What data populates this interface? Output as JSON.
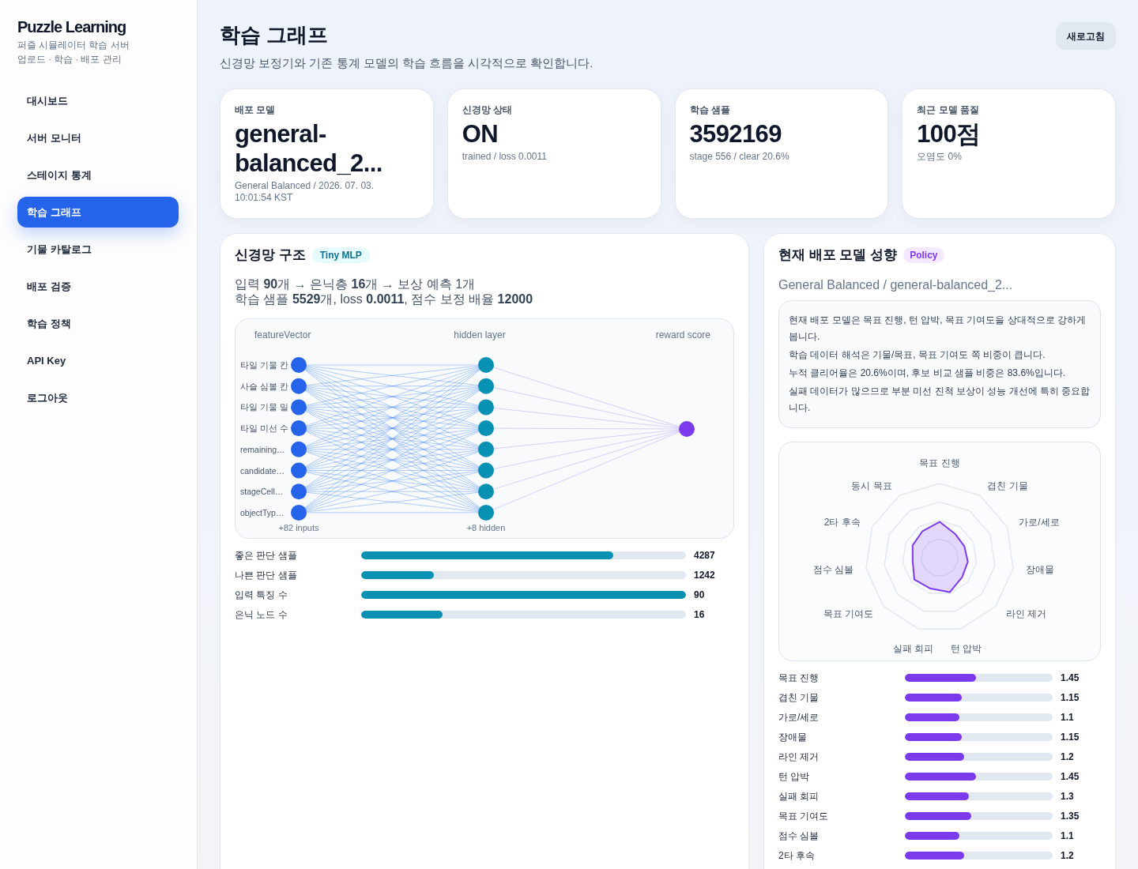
{
  "sidebar": {
    "brand": "Puzzle Learning",
    "tagline": [
      "퍼즐 시뮬레이터 학습 서버",
      "업로드 · 학습 · 배포 관리"
    ],
    "items": [
      {
        "label": "대시보드",
        "selected": false
      },
      {
        "label": "서버 모니터",
        "selected": false
      },
      {
        "label": "스테이지 통계",
        "selected": false
      },
      {
        "label": "학습 그래프",
        "selected": true
      },
      {
        "label": "기물 카탈로그",
        "selected": false
      },
      {
        "label": "배포 검증",
        "selected": false
      },
      {
        "label": "학습 정책",
        "selected": false
      },
      {
        "label": "API Key",
        "selected": false
      },
      {
        "label": "로그아웃",
        "selected": false
      }
    ]
  },
  "header": {
    "title": "학습 그래프",
    "subtitle": "신경망 보정기와 기존 통계 모델의 학습 흐름을 시각적으로 확인합니다.",
    "refresh_button": "새로고침"
  },
  "stat_cards": [
    {
      "label": "배포 모델",
      "value": "general-balanced_2...",
      "caption": "General Balanced / 2026. 07. 03. 10:01:54 KST"
    },
    {
      "label": "신경망 상태",
      "value": "ON",
      "caption": "trained / loss 0.0011"
    },
    {
      "label": "학습 샘플",
      "value": "3592169",
      "caption": "stage 556 / clear 20.6%"
    },
    {
      "label": "최근 모델 품질",
      "value": "100점",
      "caption": "오염도 0%"
    }
  ],
  "network_panel": {
    "title": "신경망 구조",
    "badge": "Tiny MLP",
    "summary": [
      "입력 **90**개 → 은닉층 **16**개 → 보상 예측 1개",
      "학습 샘플 **5529**개, loss **0.0011**, 점수 보정 배율 **12000**"
    ],
    "diagram": {
      "layers": [
        "featureVector",
        "hidden layer",
        "reward score"
      ],
      "input_features": [
        "타일 기물 칸",
        "사슬 심볼 칸",
        "타일 기물 밀",
        "타일 미선 수",
        "remaining…",
        "candidate…",
        "stageCell…",
        "objectTyp…"
      ],
      "more_inputs": "+82 inputs",
      "more_hidden": "+8 hidden"
    },
    "bars": [
      {
        "label": "좋은 판단 샘플",
        "level": 0.775,
        "value": "4287"
      },
      {
        "label": "나쁜 판단 샘플",
        "level": 0.225,
        "value": "1242"
      },
      {
        "label": "입력 특징 수",
        "level": 1,
        "value": "90"
      },
      {
        "label": "은닉 노드 수",
        "level": 0.25,
        "value": "16"
      }
    ]
  },
  "policy_panel": {
    "title": "현재 배포 모델 성향",
    "badge": "Policy",
    "model": "General Balanced / general-balanced_2...",
    "notes": [
      "현재 배포 모델은 목표 진행, 턴 압박, 목표 기여도을 상대적으로 강하게 봅니다.",
      "학습 데이터 해석은 기물/목표, 목표 기여도 쪽 비중이 큽니다.",
      "누적 클리어율은 20.6%이며, 후보 비교 샘플 비중은 83.6%입니다.",
      "실패 데이터가 많으므로 부분 미선 진척 보상이 성능 개선에 특히 중요합니다."
    ],
    "radar_axes": [
      "목표 진행",
      "동시 목표",
      "겹친 기물",
      "2타 후속",
      "가로/세로",
      "점수 심볼",
      "장애물",
      "목표 기여도",
      "라인 제거",
      "실패 회피",
      "턴 압박"
    ],
    "weights": [
      {
        "label": "목표 진행",
        "level": 0.483,
        "value": "1.45"
      },
      {
        "label": "겹친 기물",
        "level": 0.383,
        "value": "1.15"
      },
      {
        "label": "가로/세로",
        "level": 0.367,
        "value": "1.1"
      },
      {
        "label": "장애물",
        "level": 0.383,
        "value": "1.15"
      },
      {
        "label": "라인 제거",
        "level": 0.4,
        "value": "1.2"
      },
      {
        "label": "턴 압박",
        "level": 0.483,
        "value": "1.45"
      },
      {
        "label": "실패 회피",
        "level": 0.433,
        "value": "1.3"
      },
      {
        "label": "목표 기여도",
        "level": 0.45,
        "value": "1.35"
      },
      {
        "label": "점수 심볼",
        "level": 0.367,
        "value": "1.1"
      },
      {
        "label": "2타 후속",
        "level": 0.4,
        "value": "1.2"
      }
    ]
  }
}
